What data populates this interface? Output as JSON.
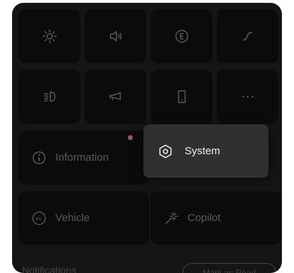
{
  "quick_toggles": {
    "row1": [
      "brightness-icon",
      "volume-icon",
      "eco-mode-icon",
      "drive-mode-icon"
    ],
    "row2": [
      "headlight-icon",
      "horn-icon",
      "phone-icon",
      "more-icon"
    ]
  },
  "tiles": {
    "information": {
      "label": "Information",
      "has_notification_dot": true
    },
    "vehicle": {
      "label": "Vehicle",
      "icon": "ev-icon"
    },
    "copilot": {
      "label": "Copilot",
      "icon": "sparkle-wand-icon"
    }
  },
  "popup": {
    "label": "System",
    "icon": "hexagon-settings-icon"
  },
  "notifications": {
    "title": "Notifications",
    "action": "Mark as Read"
  },
  "colors": {
    "panel": "#151515",
    "tile": "#0b0b0b",
    "popup": "#303030",
    "dot": "#8c5c52"
  }
}
